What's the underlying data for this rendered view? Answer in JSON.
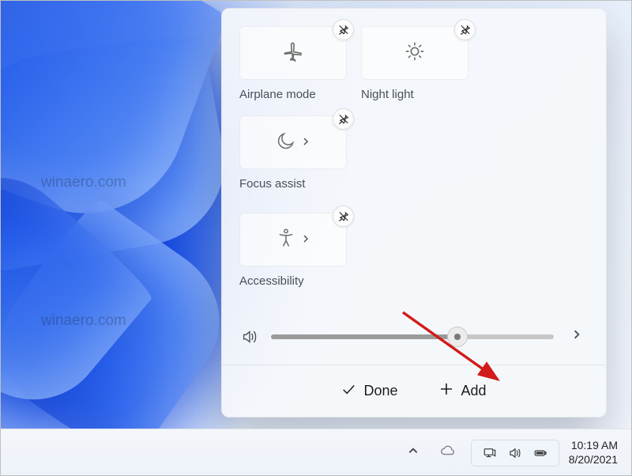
{
  "tiles": {
    "airplane": {
      "label": "Airplane mode"
    },
    "nightlight": {
      "label": "Night light"
    },
    "focusassist": {
      "label": "Focus assist"
    },
    "accessibility": {
      "label": "Accessibility"
    }
  },
  "volume": {
    "percent": 66
  },
  "footer": {
    "done": "Done",
    "add": "Add"
  },
  "taskbar": {
    "time": "10:19 AM",
    "date": "8/20/2021"
  },
  "watermark": "winaero.com"
}
